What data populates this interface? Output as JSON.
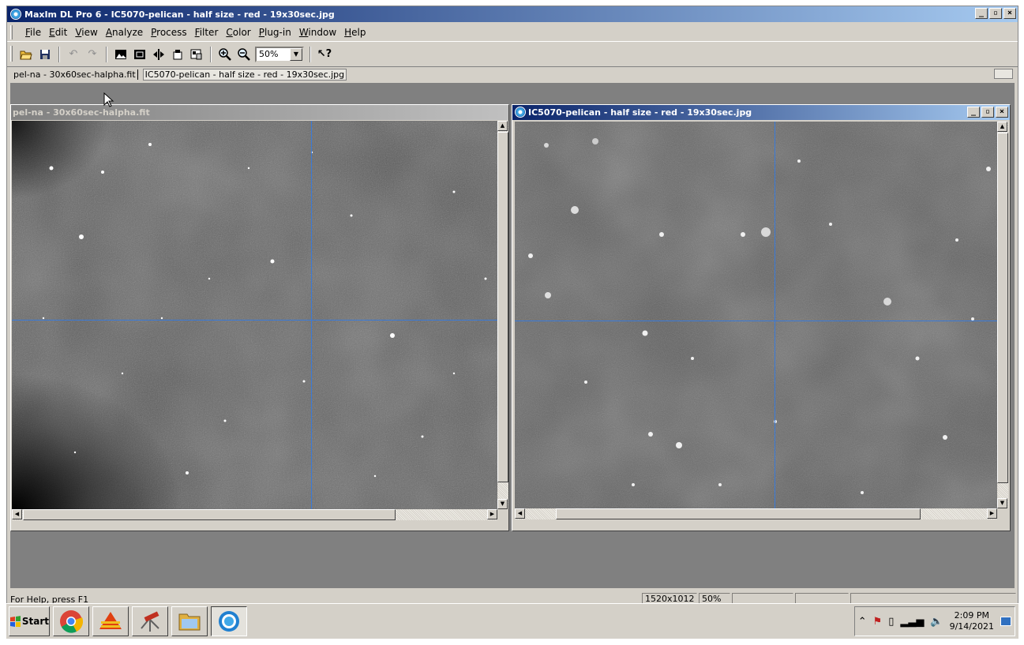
{
  "app": {
    "title": "MaxIm DL Pro 6 - IC5070-pelican - half size - red - 19x30sec.jpg",
    "controls": {
      "minimize": "_",
      "restore": "▫",
      "close": "×"
    }
  },
  "menu": [
    "File",
    "Edit",
    "View",
    "Analyze",
    "Process",
    "Filter",
    "Color",
    "Plug-in",
    "Window",
    "Help"
  ],
  "toolbar": {
    "zoom": "50%",
    "icons": [
      "open-icon",
      "save-icon",
      "undo-icon",
      "redo-icon",
      "screen-stretch-icon",
      "crop-icon",
      "flip-icon",
      "information-icon",
      "settings-icon",
      "zoom-in-icon",
      "zoom-out-icon",
      "context-help-icon"
    ]
  },
  "tabs": [
    {
      "label": "pel-na - 30x60sec-halpha.fit"
    },
    {
      "label": "IC5070-pelican - half size - red - 19x30sec.jpg"
    }
  ],
  "windows": {
    "left": {
      "title": "pel-na - 30x60sec-halpha.fit",
      "state": "inactive"
    },
    "right": {
      "title": "IC5070-pelican - half size - red - 19x30sec.jpg",
      "state": "active"
    }
  },
  "status": {
    "help": "For Help, press F1",
    "dimensions": "1520x1012",
    "zoom": "50%"
  },
  "taskbar": {
    "start_label": "Start",
    "apps": [
      "chrome-icon",
      "app-stack-icon",
      "telescope-icon",
      "explorer-icon",
      "maxim-dl-icon"
    ],
    "time": "2:09 PM",
    "date": "9/14/2021"
  },
  "colors": {
    "title_active": "#0a246a",
    "crosshair": "#3a7ad8",
    "desktop": "#808080"
  }
}
